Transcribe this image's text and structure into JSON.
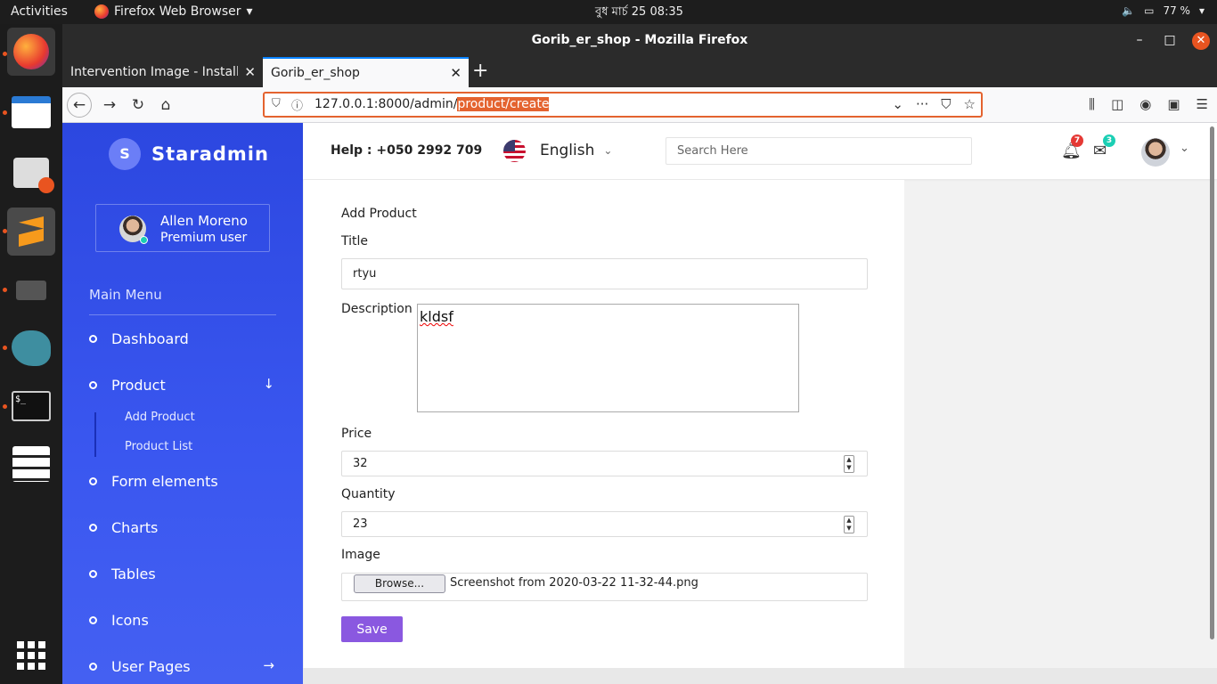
{
  "os": {
    "activities": "Activities",
    "app_name": "Firefox Web Browser",
    "clock": "বুধ মার্চ 25  08:35",
    "battery": "77 %",
    "dock_apps": [
      "firefox",
      "files",
      "software-center",
      "sublime-text",
      "video",
      "mysql-workbench",
      "terminal",
      "settings"
    ]
  },
  "browser": {
    "window_title": "Gorib_er_shop - Mozilla Firefox",
    "tabs": [
      {
        "title": "Intervention Image - Installa",
        "active": false
      },
      {
        "title": "Gorib_er_shop",
        "active": true
      }
    ],
    "url_prefix": "127.0.0.1:8000/admin/",
    "url_selected": "product/create"
  },
  "sidebar": {
    "brand_initial": "S",
    "brand_name": "Staradmin",
    "user_name": "Allen Moreno",
    "user_role": "Premium user",
    "menu_heading": "Main Menu",
    "items": [
      {
        "label": "Dashboard"
      },
      {
        "label": "Product"
      },
      {
        "label": "Form elements"
      },
      {
        "label": "Charts"
      },
      {
        "label": "Tables"
      },
      {
        "label": "Icons"
      },
      {
        "label": "User Pages"
      }
    ],
    "sub_items": [
      {
        "label": "Add Product"
      },
      {
        "label": "Product List"
      }
    ]
  },
  "header": {
    "help": "Help : +050 2992 709",
    "language": "English",
    "search_placeholder": "Search Here",
    "notifications_count": "7",
    "messages_count": "3"
  },
  "form": {
    "title": "Add Product",
    "title_label": "Title",
    "title_value": "rtyu",
    "description_label": "Description",
    "description_value": "kldsf",
    "price_label": "Price",
    "price_value": "32",
    "quantity_label": "Quantity",
    "quantity_value": "23",
    "image_label": "Image",
    "browse_label": "Browse...",
    "file_name": "Screenshot from 2020-03-22 11-32-44.png",
    "save_label": "Save"
  },
  "colors": {
    "sidebar": "#2c47e0",
    "accent": "#8a58e0",
    "url_highlight": "#e4632f",
    "notification_badge": "#e53935",
    "message_badge": "#1bcfb4"
  }
}
